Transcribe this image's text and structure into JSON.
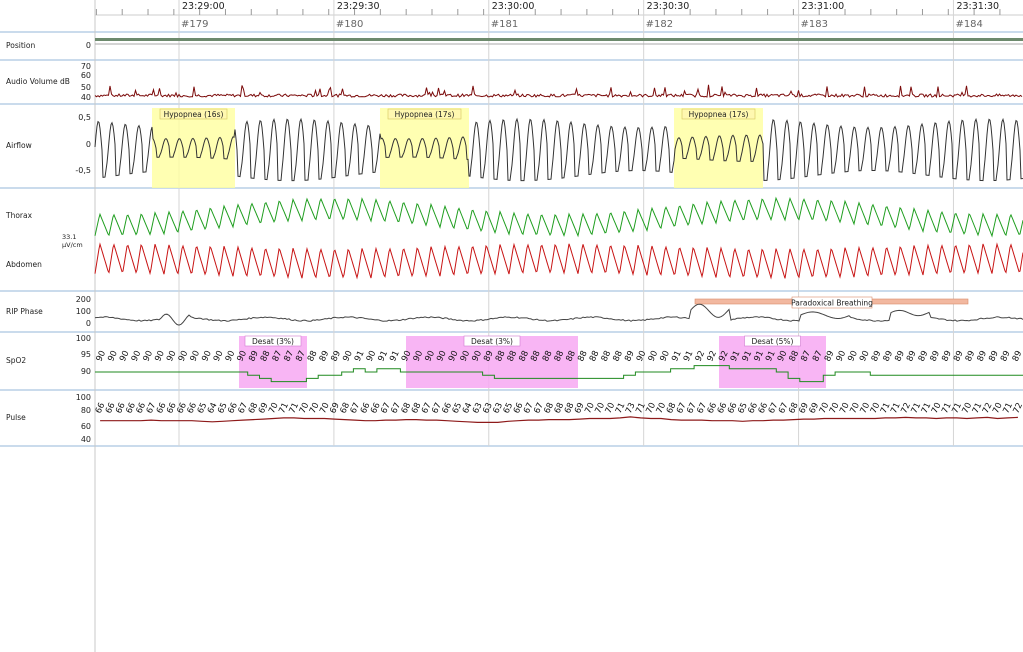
{
  "time_axis": {
    "labels": [
      "23:29:00",
      "23:29:30",
      "23:30:00",
      "23:30:30",
      "23:31:00",
      "23:31:30"
    ],
    "epochs": [
      "#179",
      "#180",
      "#181",
      "#182",
      "#183",
      "#184"
    ]
  },
  "channels": {
    "position": {
      "label": "Position",
      "ticks": [
        "0"
      ]
    },
    "audio": {
      "label": "Audio Volume dB",
      "ticks": [
        "70",
        "60",
        "50",
        "40"
      ]
    },
    "airflow": {
      "label": "Airflow",
      "ticks": [
        "0,5",
        "0",
        "-0,5"
      ]
    },
    "thorax": {
      "label": "Thorax"
    },
    "abdomen": {
      "label": "Abdomen"
    },
    "rip_scale": {
      "value": "33.1",
      "unit": "µV/cm"
    },
    "rip_phase": {
      "label": "RIP Phase",
      "ticks": [
        "200",
        "100",
        "0"
      ]
    },
    "spo2": {
      "label": "SpO2",
      "ticks": [
        "100",
        "95",
        "90"
      ]
    },
    "pulse": {
      "label": "Pulse",
      "ticks": [
        "100",
        "80",
        "60",
        "40"
      ]
    }
  },
  "events": {
    "hypopnea": [
      "Hypopnea (16s)",
      "Hypopnea (17s)",
      "Hypopnea (17s)"
    ],
    "desat": [
      "Desat (3%)",
      "Desat (3%)",
      "Desat (5%)"
    ],
    "paradoxical": "Paradoxical Breathing"
  },
  "spo2_values": [
    90,
    90,
    90,
    90,
    90,
    90,
    90,
    90,
    90,
    90,
    90,
    90,
    90,
    89,
    88,
    87,
    87,
    87,
    88,
    89,
    89,
    90,
    91,
    90,
    91,
    91,
    90,
    90,
    90,
    90,
    90,
    90,
    90,
    89,
    88,
    88,
    88,
    88,
    88,
    88,
    88,
    88,
    88,
    88,
    88,
    89,
    90,
    90,
    90,
    91,
    91,
    92,
    92,
    92,
    91,
    91,
    91,
    91,
    90,
    88,
    87,
    87,
    89,
    90,
    90,
    90,
    89,
    89,
    89,
    89,
    89,
    89,
    89,
    89,
    89,
    89,
    89,
    89,
    89
  ],
  "pulse_values": [
    66,
    66,
    66,
    66,
    66,
    67,
    66,
    66,
    66,
    66,
    65,
    64,
    65,
    66,
    67,
    68,
    69,
    70,
    71,
    71,
    70,
    70,
    70,
    69,
    68,
    67,
    66,
    66,
    67,
    67,
    68,
    68,
    67,
    67,
    66,
    65,
    64,
    63,
    63,
    63,
    65,
    66,
    67,
    67,
    68,
    68,
    68,
    69,
    70,
    70,
    70,
    71,
    73,
    71,
    70,
    70,
    68,
    67,
    67,
    67,
    66,
    66,
    66,
    65,
    66,
    66,
    67,
    67,
    68,
    69,
    69,
    70,
    70,
    70,
    70,
    70,
    70,
    71,
    71,
    72,
    71,
    71,
    70,
    71,
    71,
    70,
    71,
    72,
    70,
    71,
    72
  ]
}
